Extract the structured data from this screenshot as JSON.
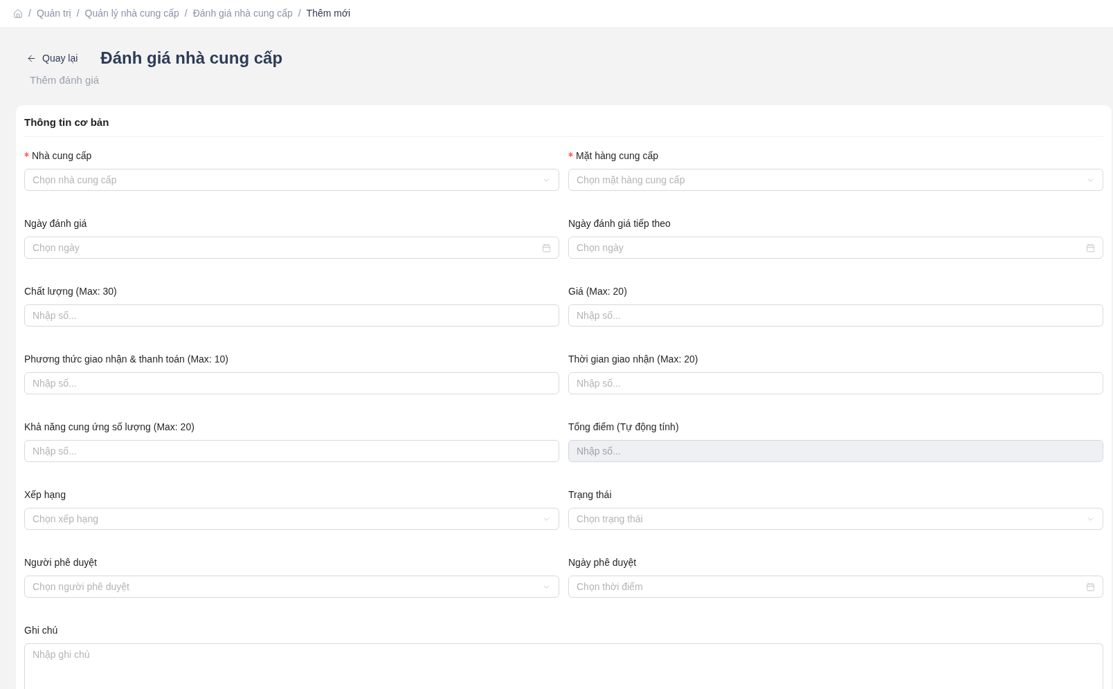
{
  "breadcrumb": {
    "items": [
      {
        "separator": "/",
        "label": "Quản trị",
        "current": false
      },
      {
        "separator": "/",
        "label": "Quản lý nhà cung cấp",
        "current": false
      },
      {
        "separator": "/",
        "label": "Đánh giá nhà cung cấp",
        "current": false
      },
      {
        "separator": "/",
        "label": "Thêm mới",
        "current": true
      }
    ]
  },
  "header": {
    "back_button": "Quay lại",
    "title": "Đánh giá nhà cung cấp",
    "subtitle": "Thêm đánh giá"
  },
  "form": {
    "section_title": "Thông tin cơ bản",
    "fields": [
      {
        "kind": "select",
        "label": "Nhà cung cấp",
        "required": true,
        "placeholder": "Chọn nhà cung cấp",
        "disabled": false
      },
      {
        "kind": "select",
        "label": "Mặt hàng cung cấp",
        "required": true,
        "placeholder": "Chọn mặt hàng cung cấp",
        "disabled": false
      },
      {
        "kind": "date",
        "label": "Ngày đánh giá",
        "required": false,
        "placeholder": "Chọn ngày",
        "disabled": false
      },
      {
        "kind": "date",
        "label": "Ngày đánh giá tiếp theo",
        "required": false,
        "placeholder": "Chọn ngày",
        "disabled": false
      },
      {
        "kind": "number",
        "label": "Chất lượng (Max: 30)",
        "required": false,
        "placeholder": "Nhập số...",
        "disabled": false
      },
      {
        "kind": "number",
        "label": "Giá (Max: 20)",
        "required": false,
        "placeholder": "Nhập số...",
        "disabled": false
      },
      {
        "kind": "number",
        "label": "Phương thức giao nhận & thanh toán (Max: 10)",
        "required": false,
        "placeholder": "Nhập số...",
        "disabled": false
      },
      {
        "kind": "number",
        "label": "Thời gian giao nhận (Max: 20)",
        "required": false,
        "placeholder": "Nhập số...",
        "disabled": false
      },
      {
        "kind": "number",
        "label": "Khả năng cung ứng số lượng (Max: 20)",
        "required": false,
        "placeholder": "Nhập số...",
        "disabled": false
      },
      {
        "kind": "number",
        "label": "Tổng điểm (Tự động tính)",
        "required": false,
        "placeholder": "Nhập số...",
        "disabled": true
      },
      {
        "kind": "select",
        "label": "Xếp hạng",
        "required": false,
        "placeholder": "Chọn xếp hạng",
        "disabled": false
      },
      {
        "kind": "select",
        "label": "Trạng thái",
        "required": false,
        "placeholder": "Chọn trạng thái",
        "disabled": false
      },
      {
        "kind": "select",
        "label": "Người phê duyệt",
        "required": false,
        "placeholder": "Chọn người phê duyệt",
        "disabled": false
      },
      {
        "kind": "date",
        "label": "Ngày phê duyệt",
        "required": false,
        "placeholder": "Chọn thời điểm",
        "disabled": false
      },
      {
        "kind": "textarea",
        "label": "Ghi chú",
        "required": false,
        "placeholder": "Nhập ghi chú",
        "disabled": false
      }
    ]
  }
}
